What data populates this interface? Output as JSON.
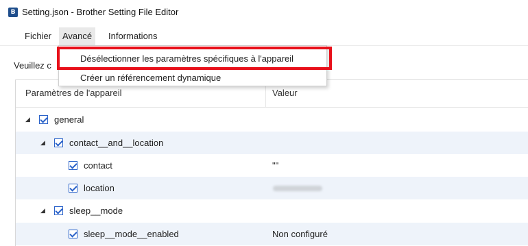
{
  "window": {
    "title": "Setting.json - Brother Setting File Editor",
    "icon": "app-icon"
  },
  "menubar": {
    "items": [
      "Fichier",
      "Avancé",
      "Informations"
    ],
    "open_menu": "Avancé"
  },
  "dropdown": {
    "items": [
      "Désélectionner les paramètres spécifiques à l'appareil",
      "Créer un référencement dynamique"
    ],
    "highlighted_item": "Désélectionner les paramètres spécifiques à l'appareil",
    "highlight_color": "#e8101a"
  },
  "main": {
    "prompt_visible": "Veuillez c"
  },
  "grid": {
    "headers": [
      "Paramètres de l'appareil",
      "Valeur"
    ],
    "rows": [
      {
        "label": "general",
        "value": "",
        "checked": true,
        "expanded": true
      },
      {
        "label": "contact__and__location",
        "value": "",
        "checked": true,
        "expanded": true
      },
      {
        "label": "contact",
        "value": "\"\"",
        "checked": true
      },
      {
        "label": "location",
        "value": "",
        "checked": true,
        "value_redacted": true
      },
      {
        "label": "sleep__mode",
        "value": "",
        "checked": true,
        "expanded": true
      },
      {
        "label": "sleep__mode__enabled",
        "value": "Non configuré",
        "checked": true
      }
    ]
  },
  "colors": {
    "checkbox": "#2a62c9",
    "alt_row": "#eef3fa",
    "menu_open": "#e9e9e9"
  }
}
